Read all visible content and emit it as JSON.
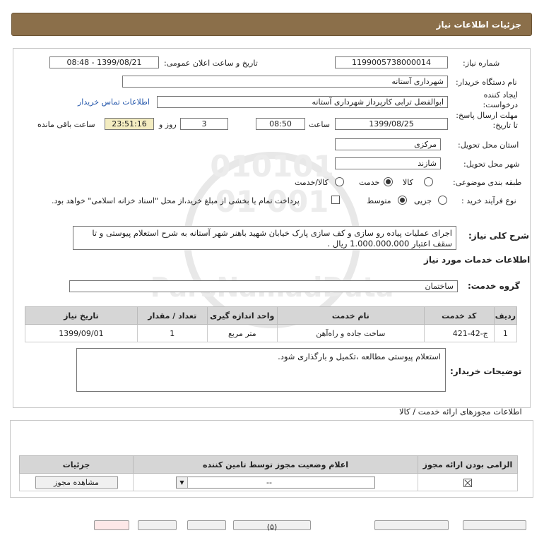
{
  "header": {
    "title": "جزئیات اطلاعات نیاز"
  },
  "form": {
    "need_number_label": "شماره نیاز:",
    "need_number": "1199005738000014",
    "announce_label": "تاریخ و ساعت اعلان عمومی:",
    "announce_value": "1399/08/21 - 08:48",
    "buyer_org_label": "نام دستگاه خریدار:",
    "buyer_org": "شهرداری آستانه",
    "creator_label": "ایجاد کننده درخواست:",
    "creator": "ابوالفضل  ترابی  کارپرداز  شهرداری آستانه",
    "contact_link": "اطلاعات تماس خریدار",
    "deadline_label": "مهلت ارسال پاسخ: تا تاریخ:",
    "deadline_date": "1399/08/25",
    "time_label": "ساعت",
    "deadline_time": "08:50",
    "days_value": "3",
    "days_label": "روز و",
    "remaining_time": "23:51:16",
    "remaining_label": "ساعت باقی مانده",
    "province_label": "استان محل تحویل:",
    "province": "مرکزی",
    "city_label": "شهر محل تحویل:",
    "city": "شازند",
    "category_label": "طبقه بندی موضوعی:",
    "category_options": [
      "کالا",
      "خدمت",
      "کالا/خدمت"
    ],
    "category_selected": "خدمت",
    "process_label": "نوع فرآیند خرید :",
    "process_options": [
      "جزیی",
      "متوسط"
    ],
    "process_selected": "متوسط",
    "payment_note": "پرداخت تمام یا بخشی از مبلغ خرید،از محل \"اسناد خزانه اسلامی\" خواهد بود."
  },
  "description": {
    "label": "شرح کلی نیاز:",
    "text": "اجرای عملیات پیاده رو سازی و کف سازی پارک خیابان شهید باهنر شهر آستانه به شرح استعلام پیوستی و تا سقف اعتبار 1.000.000.000 ریال ."
  },
  "services": {
    "section_title": "اطلاعات خدمات مورد نیاز",
    "group_label": "گروه خدمت:",
    "group_value": "ساختمان",
    "columns": [
      "ردیف",
      "کد خدمت",
      "نام خدمت",
      "واحد اندازه گیری",
      "تعداد / مقدار",
      "تاریخ نیاز"
    ],
    "rows": [
      [
        "1",
        "ج-42-421",
        "ساخت جاده و راه‌آهن",
        "متر مربع",
        "1",
        "1399/09/01"
      ]
    ]
  },
  "buyer_notes": {
    "label": "توضیحات خریدار:",
    "text": "استعلام پیوستی مطالعه ،تکمیل و بارگذاری شود."
  },
  "permits": {
    "section_title": "اطلاعات مجوزهای ارائه خدمت / کالا",
    "columns": [
      "الزامی بودن ارائه مجوز",
      "اعلام وضعیت مجوز توسط تامین کننده",
      "جزئیات"
    ],
    "select_value": "--",
    "view_button": "مشاهده مجوز"
  },
  "footer_buttons": [
    "",
    "",
    "(۵)",
    "",
    "",
    "",
    ""
  ],
  "colors": {
    "titlebar": "#8b6f4a",
    "remaining_bg": "#f3ecc0",
    "link": "#2255aa"
  }
}
